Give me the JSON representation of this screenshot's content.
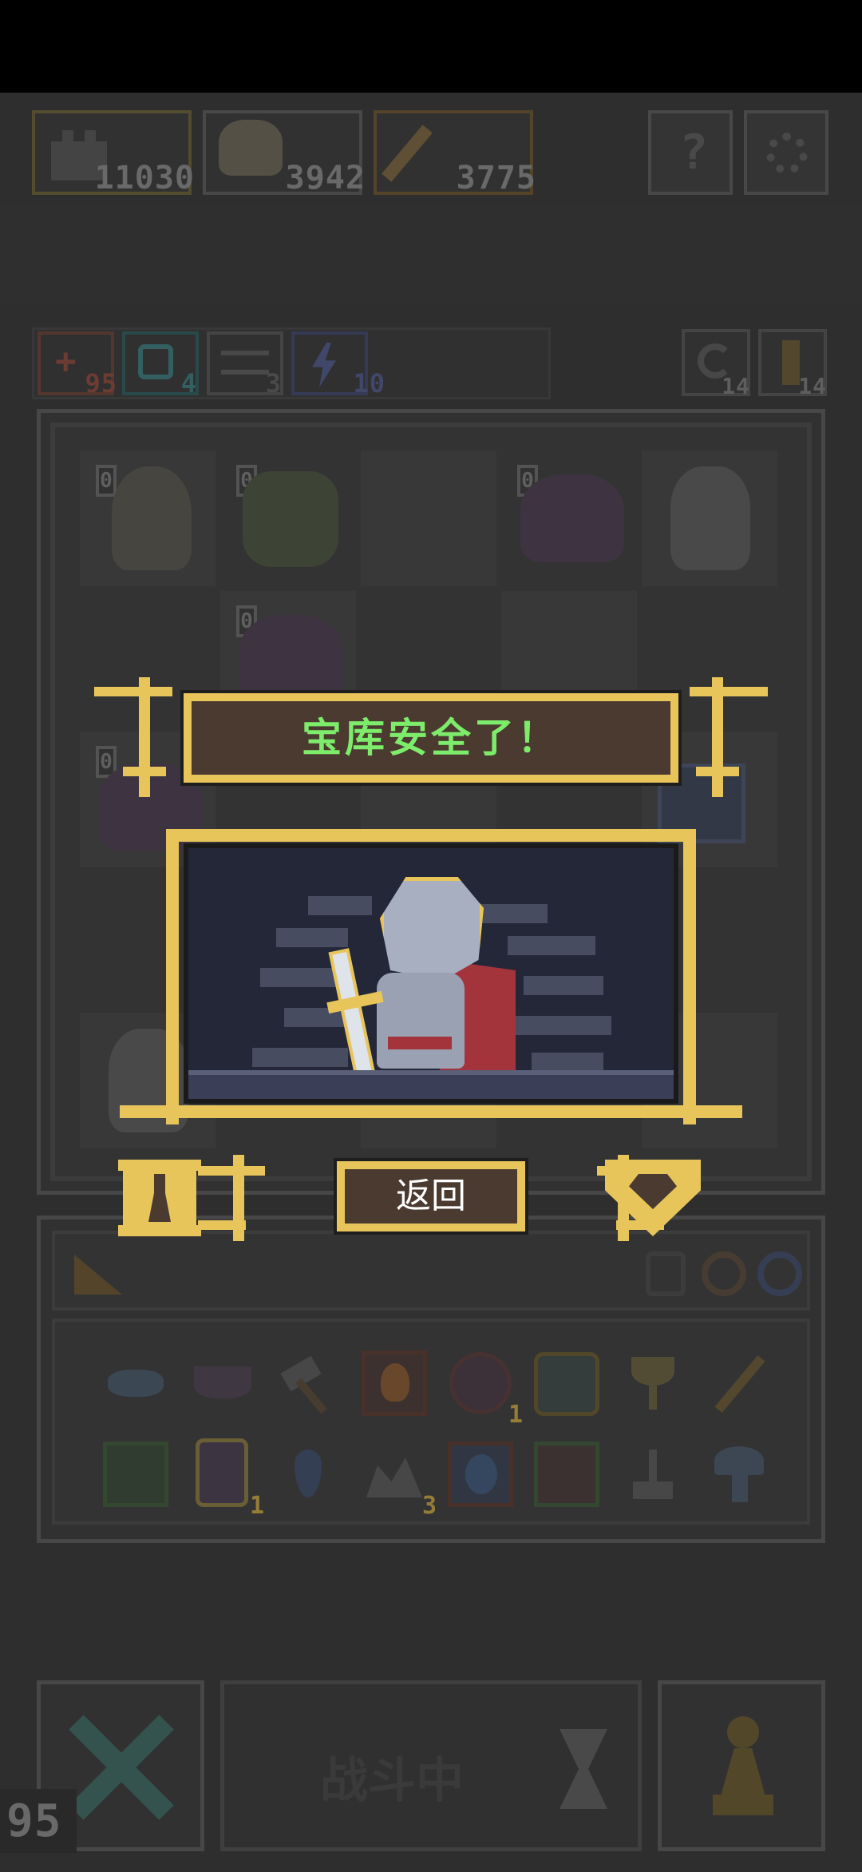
{
  "status_bar": {
    "background": "#000000"
  },
  "resources": [
    {
      "icon": "castle-icon",
      "value": "11030",
      "color": "#7b6c3e"
    },
    {
      "icon": "hero-portrait-icon",
      "value": "3942",
      "color": "#6c6c6c"
    },
    {
      "icon": "staff-icon",
      "value": "3775",
      "color": "#7b5f3a"
    }
  ],
  "top_buttons": {
    "help_icon": "question-icon",
    "settings_icon": "gear-icon"
  },
  "stats": [
    {
      "icon": "sword-plus-icon",
      "value": "95",
      "color": "#8e4a3c"
    },
    {
      "icon": "clock-icon",
      "value": "4",
      "color": "#3d7b7e"
    },
    {
      "icon": "wings-icon",
      "value": "3",
      "color": "#5c5c5c"
    },
    {
      "icon": "lightning-icon",
      "value": "10",
      "color": "#4f5a8a"
    }
  ],
  "counters": [
    {
      "icon": "refresh-icon",
      "value": "14"
    },
    {
      "icon": "key-icon",
      "value": "14"
    }
  ],
  "board": {
    "level_label": "0",
    "units": [
      {
        "name": "white-haired-witch",
        "row": 0,
        "col": 0
      },
      {
        "name": "minotaur",
        "row": 0,
        "col": 1
      },
      {
        "name": "purple-demon",
        "row": 0,
        "col": 3
      },
      {
        "name": "skeleton",
        "row": 0,
        "col": 4
      },
      {
        "name": "purple-demon",
        "row": 1,
        "col": 1
      },
      {
        "name": "purple-demon",
        "row": 2,
        "col": 0
      },
      {
        "name": "skeleton",
        "row": 4,
        "col": 0
      }
    ]
  },
  "popup": {
    "title": "宝库安全了！",
    "title_color": "#7dec6b",
    "return_button": "返回",
    "left_icon": "pawn-icon",
    "right_icon": "gem-icon",
    "scene": "knight-with-sword"
  },
  "inventory": {
    "items_row1": [
      {
        "icon": "bow-icon"
      },
      {
        "icon": "bowl-icon"
      },
      {
        "icon": "hammer-icon"
      },
      {
        "icon": "fire-scroll-icon"
      },
      {
        "icon": "demon-shield-icon",
        "count": "1"
      },
      {
        "icon": "crystal-cluster-icon"
      },
      {
        "icon": "chalice-icon"
      },
      {
        "icon": "magic-staff-icon"
      }
    ],
    "items_row2": [
      {
        "icon": "green-scroll-icon"
      },
      {
        "icon": "potion-jar-icon",
        "count": "1"
      },
      {
        "icon": "water-drop-icon"
      },
      {
        "icon": "ore-icon",
        "count": "3"
      },
      {
        "icon": "water-scroll-icon"
      },
      {
        "icon": "red-scroll-icon"
      },
      {
        "icon": "lever-icon"
      },
      {
        "icon": "mushroom-icon"
      }
    ],
    "tab_icons": [
      "cheese-icon",
      "badge-icon",
      "ring-icon",
      "orb-icon"
    ]
  },
  "bottom_bar": {
    "battle_label": "战斗中",
    "cancel_icon": "close-icon",
    "hourglass_icon": "hourglass-icon",
    "pawn_icon": "pawn-icon"
  },
  "fps": "95"
}
